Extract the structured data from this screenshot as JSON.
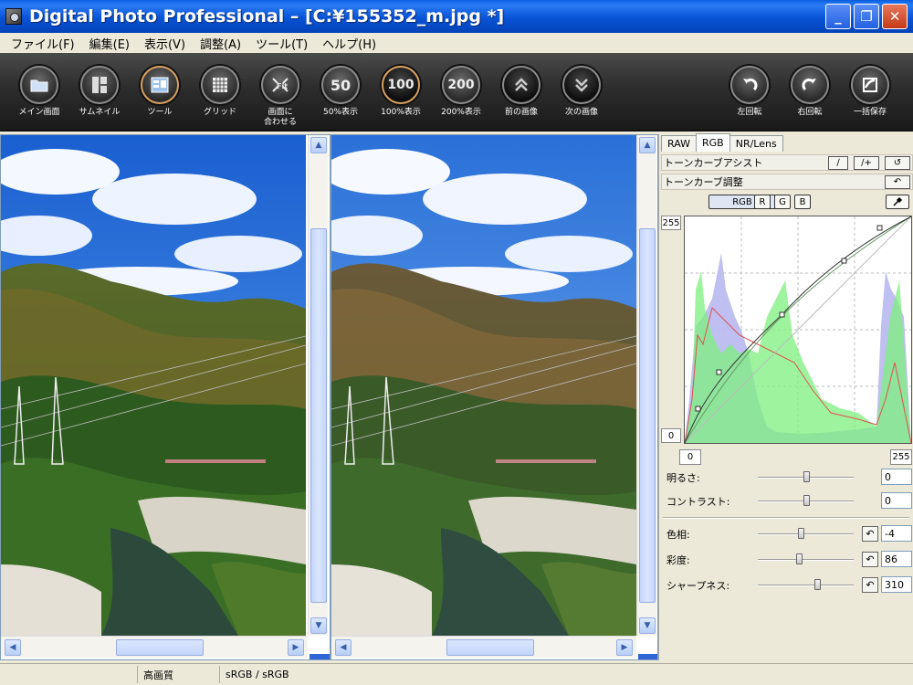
{
  "window": {
    "title": "Digital Photo Professional – [C:¥155352_m.jpg *]",
    "minimize_glyph": "_",
    "maximize_glyph": "❐",
    "close_glyph": "✕"
  },
  "menu": [
    "ファイル(F)",
    "編集(E)",
    "表示(V)",
    "調整(A)",
    "ツール(T)",
    "ヘルプ(H)"
  ],
  "toolbar": {
    "main_window": "メイン画面",
    "thumbnail": "サムネイル",
    "tool": "ツール",
    "grid": "グリッド",
    "fit_screen_1": "画面に",
    "fit_screen_2": "合わせる",
    "zoom50": "50%表示",
    "zoom50_glyph": "50",
    "zoom100": "100%表示",
    "zoom100_glyph": "100",
    "zoom200": "200%表示",
    "zoom200_glyph": "200",
    "prev_image": "前の画像",
    "next_image": "次の画像",
    "rotate_left": "左回転",
    "rotate_right": "右回転",
    "batch_save": "一括保存"
  },
  "panel": {
    "tabs": [
      "RAW",
      "RGB",
      "NR/Lens"
    ],
    "active_tab": "RGB",
    "tone_curve_assist": "トーンカーブアシスト",
    "tone_curve_adjust": "トーンカーブ調整",
    "channels": [
      "RGB",
      "R",
      "G",
      "B"
    ],
    "graph_max": "255",
    "graph_min": "0",
    "input_min": "0",
    "input_max": "255",
    "sliders": [
      {
        "label": "明るさ:",
        "value": "0",
        "position": 0.5
      },
      {
        "label": "コントラスト:",
        "value": "0",
        "position": 0.5
      },
      {
        "label": "色相:",
        "value": "-4",
        "position": 0.45
      },
      {
        "label": "彩度:",
        "value": "86",
        "position": 0.43
      },
      {
        "label": "シャープネス:",
        "value": "310",
        "position": 0.62
      }
    ]
  },
  "status": {
    "quality": "高画質",
    "color_space": "sRGB / sRGB"
  },
  "colors": {
    "title_bar": "#0853d6",
    "accent": "#2f66d8",
    "histogram_blue": "#b8b8f0",
    "histogram_green": "#7ef07e"
  }
}
